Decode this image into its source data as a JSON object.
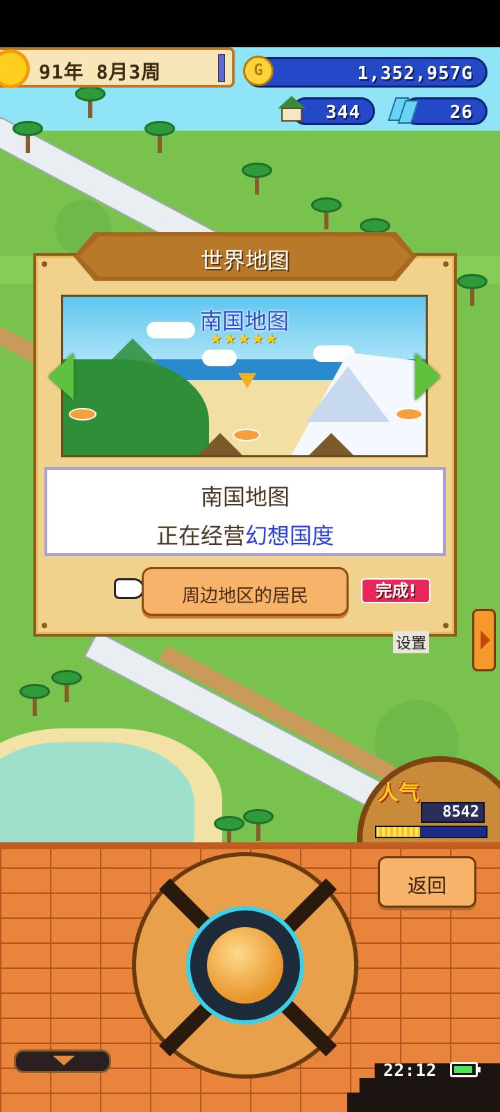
{
  "hud": {
    "date_text": "91年 8月3周",
    "money": "1,352,957G",
    "coin_symbol": "G",
    "houses": "344",
    "crystals": "26"
  },
  "dialog": {
    "title": "世界地图",
    "map_name": "南国地图",
    "stars": "★★★★★",
    "info_title": "南国地图",
    "info_prefix": "正在经营",
    "info_highlight": "幻想国度",
    "action_label": "周边地区的居民",
    "badge": "完成!"
  },
  "scene": {
    "sign_text": "设置"
  },
  "popularity": {
    "label": "人气",
    "value": "8542",
    "level": 0.4
  },
  "controls": {
    "back_label": "返回"
  },
  "status": {
    "time": "22:12"
  },
  "colors": {
    "accent_blue": "#2348c8",
    "highlight": "#2a3fd0",
    "badge": "#e8285a",
    "brick": "#e8843c"
  }
}
